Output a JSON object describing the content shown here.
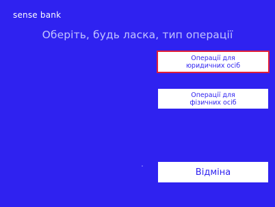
{
  "brand": {
    "logo_text": "sense bank"
  },
  "screen": {
    "title": "Оберіть, будь ласка, тип операції"
  },
  "options": {
    "legal_entities_label": "Операції для\nюридичних осіб",
    "individuals_label": "Операції для\nфізичних осіб",
    "cancel_label": "Відміна"
  },
  "colors": {
    "background": "#2f22f0",
    "title": "#c2c4ff",
    "button_bg": "#ffffff",
    "button_text": "#2f22f0",
    "selected_border": "#e01e37"
  },
  "icons": {
    "logo": "sense-bank-logo"
  }
}
